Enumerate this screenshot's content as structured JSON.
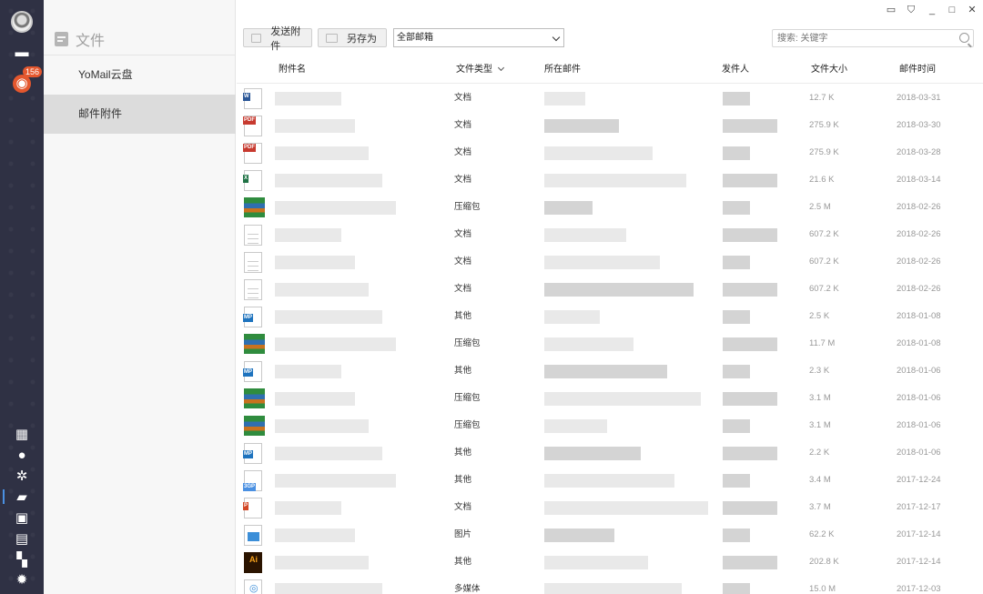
{
  "window": {
    "controls": [
      "feedback-icon",
      "skin-icon",
      "minimize-icon",
      "maximize-icon",
      "close-icon"
    ]
  },
  "rail": {
    "badge_count": "156"
  },
  "panel": {
    "title": "文件",
    "nav": [
      "YoMail云盘",
      "邮件附件"
    ],
    "selected_index": 1
  },
  "toolbar": {
    "send_label": "发送附件",
    "save_as_label": "另存为",
    "mailbox_selected": "全部邮箱",
    "search_placeholder": "搜索: 关键字"
  },
  "table": {
    "headers": {
      "name": "附件名",
      "type": "文件类型",
      "mail": "所在邮件",
      "sender": "发件人",
      "size": "文件大小",
      "time": "邮件时间"
    },
    "rows": [
      {
        "icon": "word-doc-icon",
        "type": "文档",
        "size": "12.7 K",
        "date": "2018-03-31"
      },
      {
        "icon": "pdf-icon",
        "type": "文档",
        "size": "275.9 K",
        "date": "2018-03-30"
      },
      {
        "icon": "pdf-icon",
        "type": "文档",
        "size": "275.9 K",
        "date": "2018-03-28"
      },
      {
        "icon": "excel-icon",
        "type": "文档",
        "size": "21.6 K",
        "date": "2018-03-14"
      },
      {
        "icon": "archive-icon",
        "type": "压缩包",
        "size": "2.5 M",
        "date": "2018-02-26"
      },
      {
        "icon": "text-doc-icon",
        "type": "文档",
        "size": "607.2 K",
        "date": "2018-02-26"
      },
      {
        "icon": "text-doc-icon",
        "type": "文档",
        "size": "607.2 K",
        "date": "2018-02-26"
      },
      {
        "icon": "text-doc-icon",
        "type": "文档",
        "size": "607.2 K",
        "date": "2018-02-26"
      },
      {
        "icon": "mp-file-icon",
        "type": "其他",
        "size": "2.5 K",
        "date": "2018-01-08"
      },
      {
        "icon": "archive-icon",
        "type": "压缩包",
        "size": "11.7 M",
        "date": "2018-01-08"
      },
      {
        "icon": "mp-file-icon",
        "type": "其他",
        "size": "2.3 K",
        "date": "2018-01-06"
      },
      {
        "icon": "archive-icon",
        "type": "压缩包",
        "size": "3.1 M",
        "date": "2018-01-06"
      },
      {
        "icon": "archive-icon",
        "type": "压缩包",
        "size": "3.1 M",
        "date": "2018-01-06"
      },
      {
        "icon": "mp-file-icon",
        "type": "其他",
        "size": "2.2 K",
        "date": "2018-01-06"
      },
      {
        "icon": "video-file-icon",
        "type": "其他",
        "size": "3.4 M",
        "date": "2017-12-24"
      },
      {
        "icon": "ppt-icon",
        "type": "文档",
        "size": "3.7 M",
        "date": "2017-12-17"
      },
      {
        "icon": "image-file-icon",
        "type": "图片",
        "size": "62.2 K",
        "date": "2017-12-14"
      },
      {
        "icon": "ai-file-icon",
        "type": "其他",
        "size": "202.8 K",
        "date": "2017-12-14"
      },
      {
        "icon": "media-file-icon",
        "type": "多媒体",
        "size": "15.0 M",
        "date": "2017-12-03"
      }
    ]
  }
}
